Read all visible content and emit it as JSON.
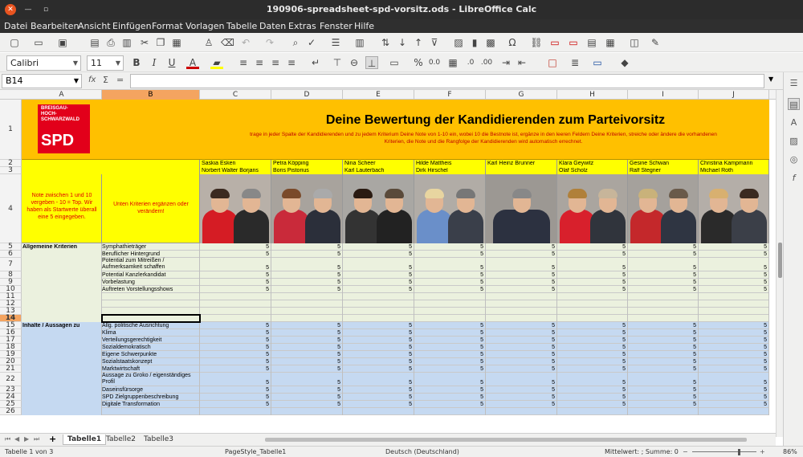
{
  "window": {
    "title": "190906-spreadsheet-spd-vorsitz.ods - LibreOffice Calc"
  },
  "menu": [
    "Datei",
    "Bearbeiten",
    "Ansicht",
    "Einfügen",
    "Format",
    "Vorlagen",
    "Tabelle",
    "Daten",
    "Extras",
    "Fenster",
    "Hilfe"
  ],
  "format": {
    "font_name": "Calibri",
    "font_size": "11"
  },
  "formula": {
    "name_box": "B14",
    "fx": "fx",
    "sum": "Σ",
    "eq": "="
  },
  "columns": [
    "A",
    "B",
    "C",
    "D",
    "E",
    "F",
    "G",
    "H",
    "I",
    "J"
  ],
  "selected_column": "B",
  "selected_row": "14",
  "header": {
    "logo_line1": "BREISGAU-",
    "logo_line2": "HOCH-",
    "logo_line3": "SCHWARZWALD",
    "logo_text": "SPD",
    "title": "Deine Bewertung der Kandidierenden zum Parteivorsitz",
    "subtitle_line1": "trage in jeder Spalte der Kandidierenden und zu jedem Kriterium Deine Note von 1-10 ein, wobei 10 die Bestnote ist, ergänze in den leeren Feldern Deine Kriterien, streiche oder ändere die vorhandenen",
    "subtitle_line2": "Kriterien, die Note und die Rangfolge der Kandidierenden wird automatisch errechnet."
  },
  "candidates": [
    {
      "n1": "Saskia Esken",
      "n2": "Norbert Walter Borjans",
      "bg": "#b8b0a8"
    },
    {
      "n1": "Petra Köpping",
      "n2": "Boris Pistorius",
      "bg": "#a8a39d"
    },
    {
      "n1": "Nina Scheer",
      "n2": "Karl Lauterbach",
      "bg": "#a9a7a3"
    },
    {
      "n1": "Hilde Mattheis",
      "n2": "Dirk Hirschel",
      "bg": "#b1aca6"
    },
    {
      "n1": "Karl Heinz Brunner",
      "n2": "",
      "bg": "#9c9893"
    },
    {
      "n1": "Klara Geywitz",
      "n2": "Olaf Scholz",
      "bg": "#aaa59f"
    },
    {
      "n1": "Gesine Schwan",
      "n2": "Ralf Stegner",
      "bg": "#a5a19c"
    },
    {
      "n1": "Christina Kampmann",
      "n2": "Michael Roth",
      "bg": "#b4aea8"
    }
  ],
  "note_text": "Note zwischen 1 und 10 vergeben - 10 = Top. Wir haben als Startwerte überall eine 5 eingegeben.",
  "b4_text": "Unten Kriterien ergänzen  oder verändern!",
  "sections": [
    {
      "label": "Allgemeine Kriterien",
      "criteria": [
        "Symphathieträger",
        "Beruflicher Hintergrund",
        "Potential zum Mitreißen / Aufmerksamkeit schaffen",
        "Potential Kanzlerkandidat",
        "Vorbelastung",
        "Auftreten Vorstellungsshows"
      ]
    },
    {
      "label": "Inhalte / Aussagen zu",
      "criteria": [
        "Allg. politische Ausrichtung",
        "Klima",
        "Verteilungsgerechtigkeit",
        "Sozialdemokratisch",
        "Eigene Schwerpunkte",
        "Sozialstaatskonzept",
        "Marktwirtschaft",
        "Aussage zu Groko / eigenständiges Profil",
        "Daseinsfürsorge",
        "SPD Zielgruppenbeschreibung",
        "Digitale Transformation"
      ]
    }
  ],
  "score_value": "5",
  "rows": [
    "1",
    "2",
    "3",
    "4",
    "5",
    "6",
    "7",
    "8",
    "9",
    "10",
    "11",
    "12",
    "13",
    "14",
    "15",
    "16",
    "17",
    "18",
    "19",
    "20",
    "21",
    "22",
    "23",
    "24",
    "25",
    "26"
  ],
  "sheets": [
    "Tabelle1",
    "Tabelle2",
    "Tabelle3"
  ],
  "status": {
    "sheet_pos": "Tabelle 1 von 3",
    "page_style": "PageStyle_Tabelle1",
    "lang": "Deutsch (Deutschland)",
    "summary": "Mittelwert: ; Summe: 0",
    "zoom": "86%"
  },
  "colors": {
    "header_band": "#ffc000",
    "yellow": "#ffff00",
    "section1": "#ebf1de",
    "section2": "#c5d9f1",
    "spd_red": "#e2001a"
  }
}
